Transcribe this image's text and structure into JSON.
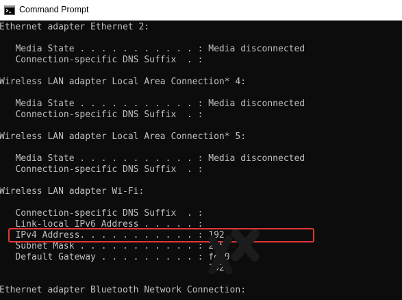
{
  "window": {
    "title": "Command Prompt",
    "icon": "command-prompt-icon"
  },
  "console": {
    "lines": [
      "Ethernet adapter Ethernet 2:",
      "",
      "   Media State . . . . . . . . . . . : Media disconnected",
      "   Connection-specific DNS Suffix  . :",
      "",
      "Wireless LAN adapter Local Area Connection* 4:",
      "",
      "   Media State . . . . . . . . . . . : Media disconnected",
      "   Connection-specific DNS Suffix  . :",
      "",
      "Wireless LAN adapter Local Area Connection* 5:",
      "",
      "   Media State . . . . . . . . . . . : Media disconnected",
      "   Connection-specific DNS Suffix  . :",
      "",
      "Wireless LAN adapter Wi-Fi:",
      "",
      "   Connection-specific DNS Suffix  . :",
      "   Link-local IPv6 Address . . . . . :",
      "   IPv4 Address. . . . . . . . . . . : 192.",
      "   Subnet Mask . . . . . . . . . . . : 255.",
      "   Default Gateway . . . . . . . . . : fe80",
      "                                       192.",
      "",
      "Ethernet adapter Bluetooth Network Connection:"
    ]
  },
  "highlight": {
    "color": "#e23636"
  },
  "colors": {
    "console_background": "#0c0c0c",
    "console_text": "#c0c0c0",
    "titlebar_background": "#ffffff"
  }
}
